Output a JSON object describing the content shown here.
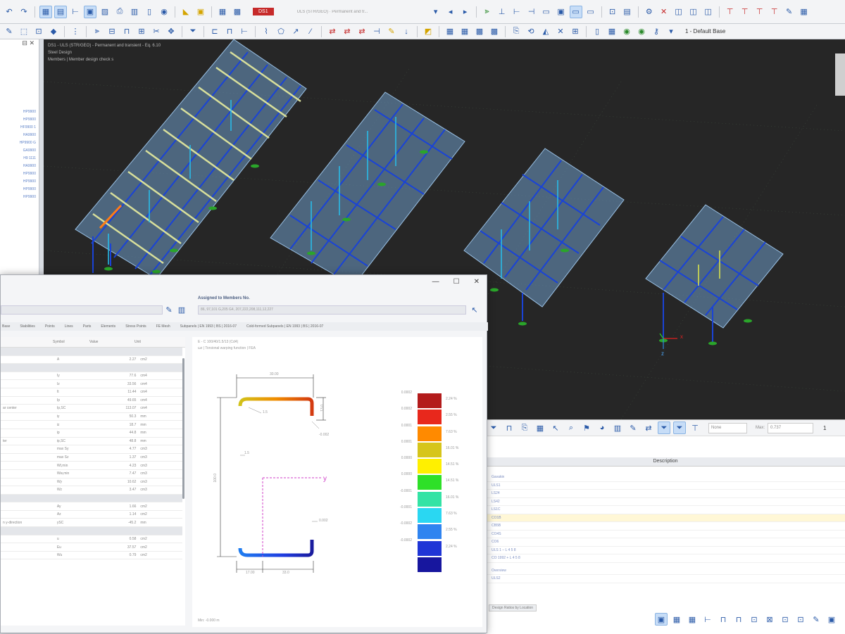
{
  "toolbar": {
    "load_case_code": "DS1",
    "load_case_label": "ULS (STR/GEO) · Permanent and tr...",
    "view_label": "1 - Default Base"
  },
  "left_panel": {
    "items": [
      "HP9900",
      "HP9900",
      "HF9900 1",
      "HA9900",
      "HP9900 G",
      "GA9900",
      "H9 1111",
      "HA9900",
      "HP9900",
      "HP9900",
      "HP9900",
      "HP9900"
    ]
  },
  "viewport": {
    "header_lines": [
      "DS1 - ULS (STR/GEO) - Permanent and transient - Eq. 6.10",
      "Steel Design",
      "Members | Member design check s"
    ],
    "axes": {
      "x": "x",
      "y": "y",
      "z": "z"
    }
  },
  "dialog": {
    "assigned_label": "Assigned to Members No.",
    "assigned_value": "86, 97,101 G,205 G4, 207,222,208,111,12,227",
    "tabs": [
      "Base",
      "Stabilities",
      "Points",
      "Lines",
      "Parts",
      "Elements",
      "Stress Points",
      "FE Mesh",
      "Subpanels | EN 1993 | BS | 2016-07",
      "Cold-formed Subpanels | EN 1993 | BS | 2016-07"
    ],
    "columns": {
      "symbol": "Symbol",
      "value": "Value",
      "unit": "Unit"
    },
    "rows": [
      {
        "name": "",
        "sym": "",
        "val": "",
        "unit": "",
        "grp": true
      },
      {
        "name": "",
        "sym": "A",
        "val": "2.27",
        "unit": "cm2"
      },
      {
        "name": "",
        "sym": "",
        "val": "",
        "unit": "",
        "grp": true
      },
      {
        "name": "",
        "sym": "Iy",
        "val": "77.6",
        "unit": "cm4"
      },
      {
        "name": "",
        "sym": "Iz",
        "val": "33.56",
        "unit": "cm4"
      },
      {
        "name": "",
        "sym": "It",
        "val": "11.44",
        "unit": "cm4"
      },
      {
        "name": "",
        "sym": "Ip",
        "val": "49.65",
        "unit": "cm4"
      },
      {
        "name": "ar center",
        "sym": "Ip,SC",
        "val": "113.07",
        "unit": "cm4"
      },
      {
        "name": "",
        "sym": "iy",
        "val": "50.3",
        "unit": "mm"
      },
      {
        "name": "",
        "sym": "iz",
        "val": "18.7",
        "unit": "mm"
      },
      {
        "name": "",
        "sym": "ip",
        "val": "44.8",
        "unit": "mm"
      },
      {
        "name": "ter",
        "sym": "ip,SC",
        "val": "48.8",
        "unit": "mm"
      },
      {
        "name": "",
        "sym": "max Sy",
        "val": "4.77",
        "unit": "cm3"
      },
      {
        "name": "",
        "sym": "max Sz",
        "val": "1.37",
        "unit": "cm3"
      },
      {
        "name": "",
        "sym": "Wt,min",
        "val": "4.23",
        "unit": "cm3"
      },
      {
        "name": "",
        "sym": "Ww,min",
        "val": "7.47",
        "unit": "cm3"
      },
      {
        "name": "",
        "sym": "Wy",
        "val": "10.62",
        "unit": "cm3"
      },
      {
        "name": "",
        "sym": "Wz",
        "val": "3.47",
        "unit": "cm3"
      },
      {
        "name": "",
        "sym": "",
        "val": "",
        "unit": "",
        "grp": true
      },
      {
        "name": "",
        "sym": "Ay",
        "val": "1.66",
        "unit": "cm2"
      },
      {
        "name": "",
        "sym": "Az",
        "val": "1.14",
        "unit": "cm2"
      },
      {
        "name": "n y-direction",
        "sym": "ySC",
        "val": "-45.2",
        "unit": "mm"
      },
      {
        "name": "",
        "sym": "",
        "val": "",
        "unit": "",
        "grp": true
      },
      {
        "name": "",
        "sym": "u",
        "val": "0.58",
        "unit": "cm2"
      },
      {
        "name": "",
        "sym": "Eu",
        "val": "37.57",
        "unit": "cm2"
      },
      {
        "name": "",
        "sym": "Wu",
        "val": "0.79",
        "unit": "cm2"
      }
    ],
    "section_title": "E - C 100/40/1.5/13 (Cd4)",
    "section_subtitle": "ωz | Torsional warping function | FEA",
    "dims": {
      "top": "30.00",
      "left": "100.0",
      "lip": "13.0",
      "bottom_a": "17.00",
      "bottom_b": "33.0",
      "t1": "1.5",
      "t2": "1.5"
    },
    "cut_labels": {
      "right_top": "-0.002",
      "right_mid": "0.002"
    },
    "axis_y": "y",
    "footer_text": "Min: -0.000 m",
    "legend": {
      "values": [
        "0.0002",
        "0.0002",
        "0.0001",
        "0.0001",
        "0.0000",
        "0.0000",
        "-0.0001",
        "-0.0001",
        "-0.0002",
        "-0.0002"
      ],
      "percents": [
        "2.24 %",
        "2.55 %",
        "7.63 %",
        "16.01 %",
        "14.51 %",
        "14.51 %",
        "16.01 %",
        "7.63 %",
        "2.55 %",
        "2.24 %"
      ],
      "colors": [
        "#b31b1b",
        "#e8281c",
        "#ff8a00",
        "#d6c51b",
        "#fff000",
        "#2ee028",
        "#34e3a5",
        "#2ad7f2",
        "#2f84f0",
        "#1f35d6",
        "#17169e"
      ]
    }
  },
  "results": {
    "filter": "None",
    "max_label": "Max:",
    "max_value": "0.737",
    "page": "1",
    "header": "Description",
    "rows": [
      "Gavakin",
      "ULS1",
      "LS24",
      "LS42",
      "LS1C",
      "CO1B",
      "CB5B",
      "CO4S",
      "CO6",
      "ULS 1 – L 4 5 8",
      "CO 1992 + L 4 5 8"
    ],
    "extra_rows": [
      "Overview",
      "ULS2"
    ],
    "bottom_tab": "Design Ratios by Location"
  }
}
